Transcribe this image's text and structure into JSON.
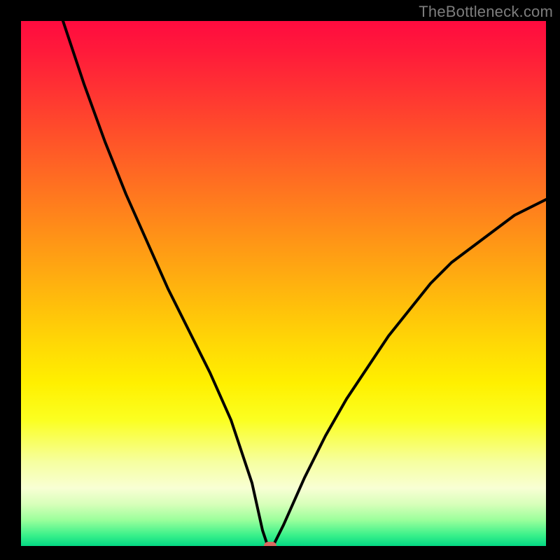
{
  "watermark": "TheBottleneck.com",
  "colors": {
    "background": "#000000",
    "curve": "#000000",
    "marker": "#d86a60"
  },
  "chart_data": {
    "type": "line",
    "title": "",
    "xlabel": "",
    "ylabel": "",
    "xlim": [
      0,
      100
    ],
    "ylim": [
      0,
      100
    ],
    "grid": false,
    "legend": false,
    "note": "V-shaped bottleneck curve over a rainbow gradient background; minimum at x≈47. The gradient encodes severity (red=high, green=low). Values are estimated from pixel positions.",
    "series": [
      {
        "name": "bottleneck-curve",
        "x": [
          8,
          12,
          16,
          20,
          24,
          28,
          32,
          36,
          40,
          44,
          46,
          47,
          48,
          50,
          54,
          58,
          62,
          66,
          70,
          74,
          78,
          82,
          86,
          90,
          94,
          98,
          100
        ],
        "values": [
          100,
          88,
          77,
          67,
          58,
          49,
          41,
          33,
          24,
          12,
          3,
          0,
          0,
          4,
          13,
          21,
          28,
          34,
          40,
          45,
          50,
          54,
          57,
          60,
          63,
          65,
          66
        ]
      }
    ],
    "marker": {
      "x": 47.5,
      "y": 0
    }
  }
}
